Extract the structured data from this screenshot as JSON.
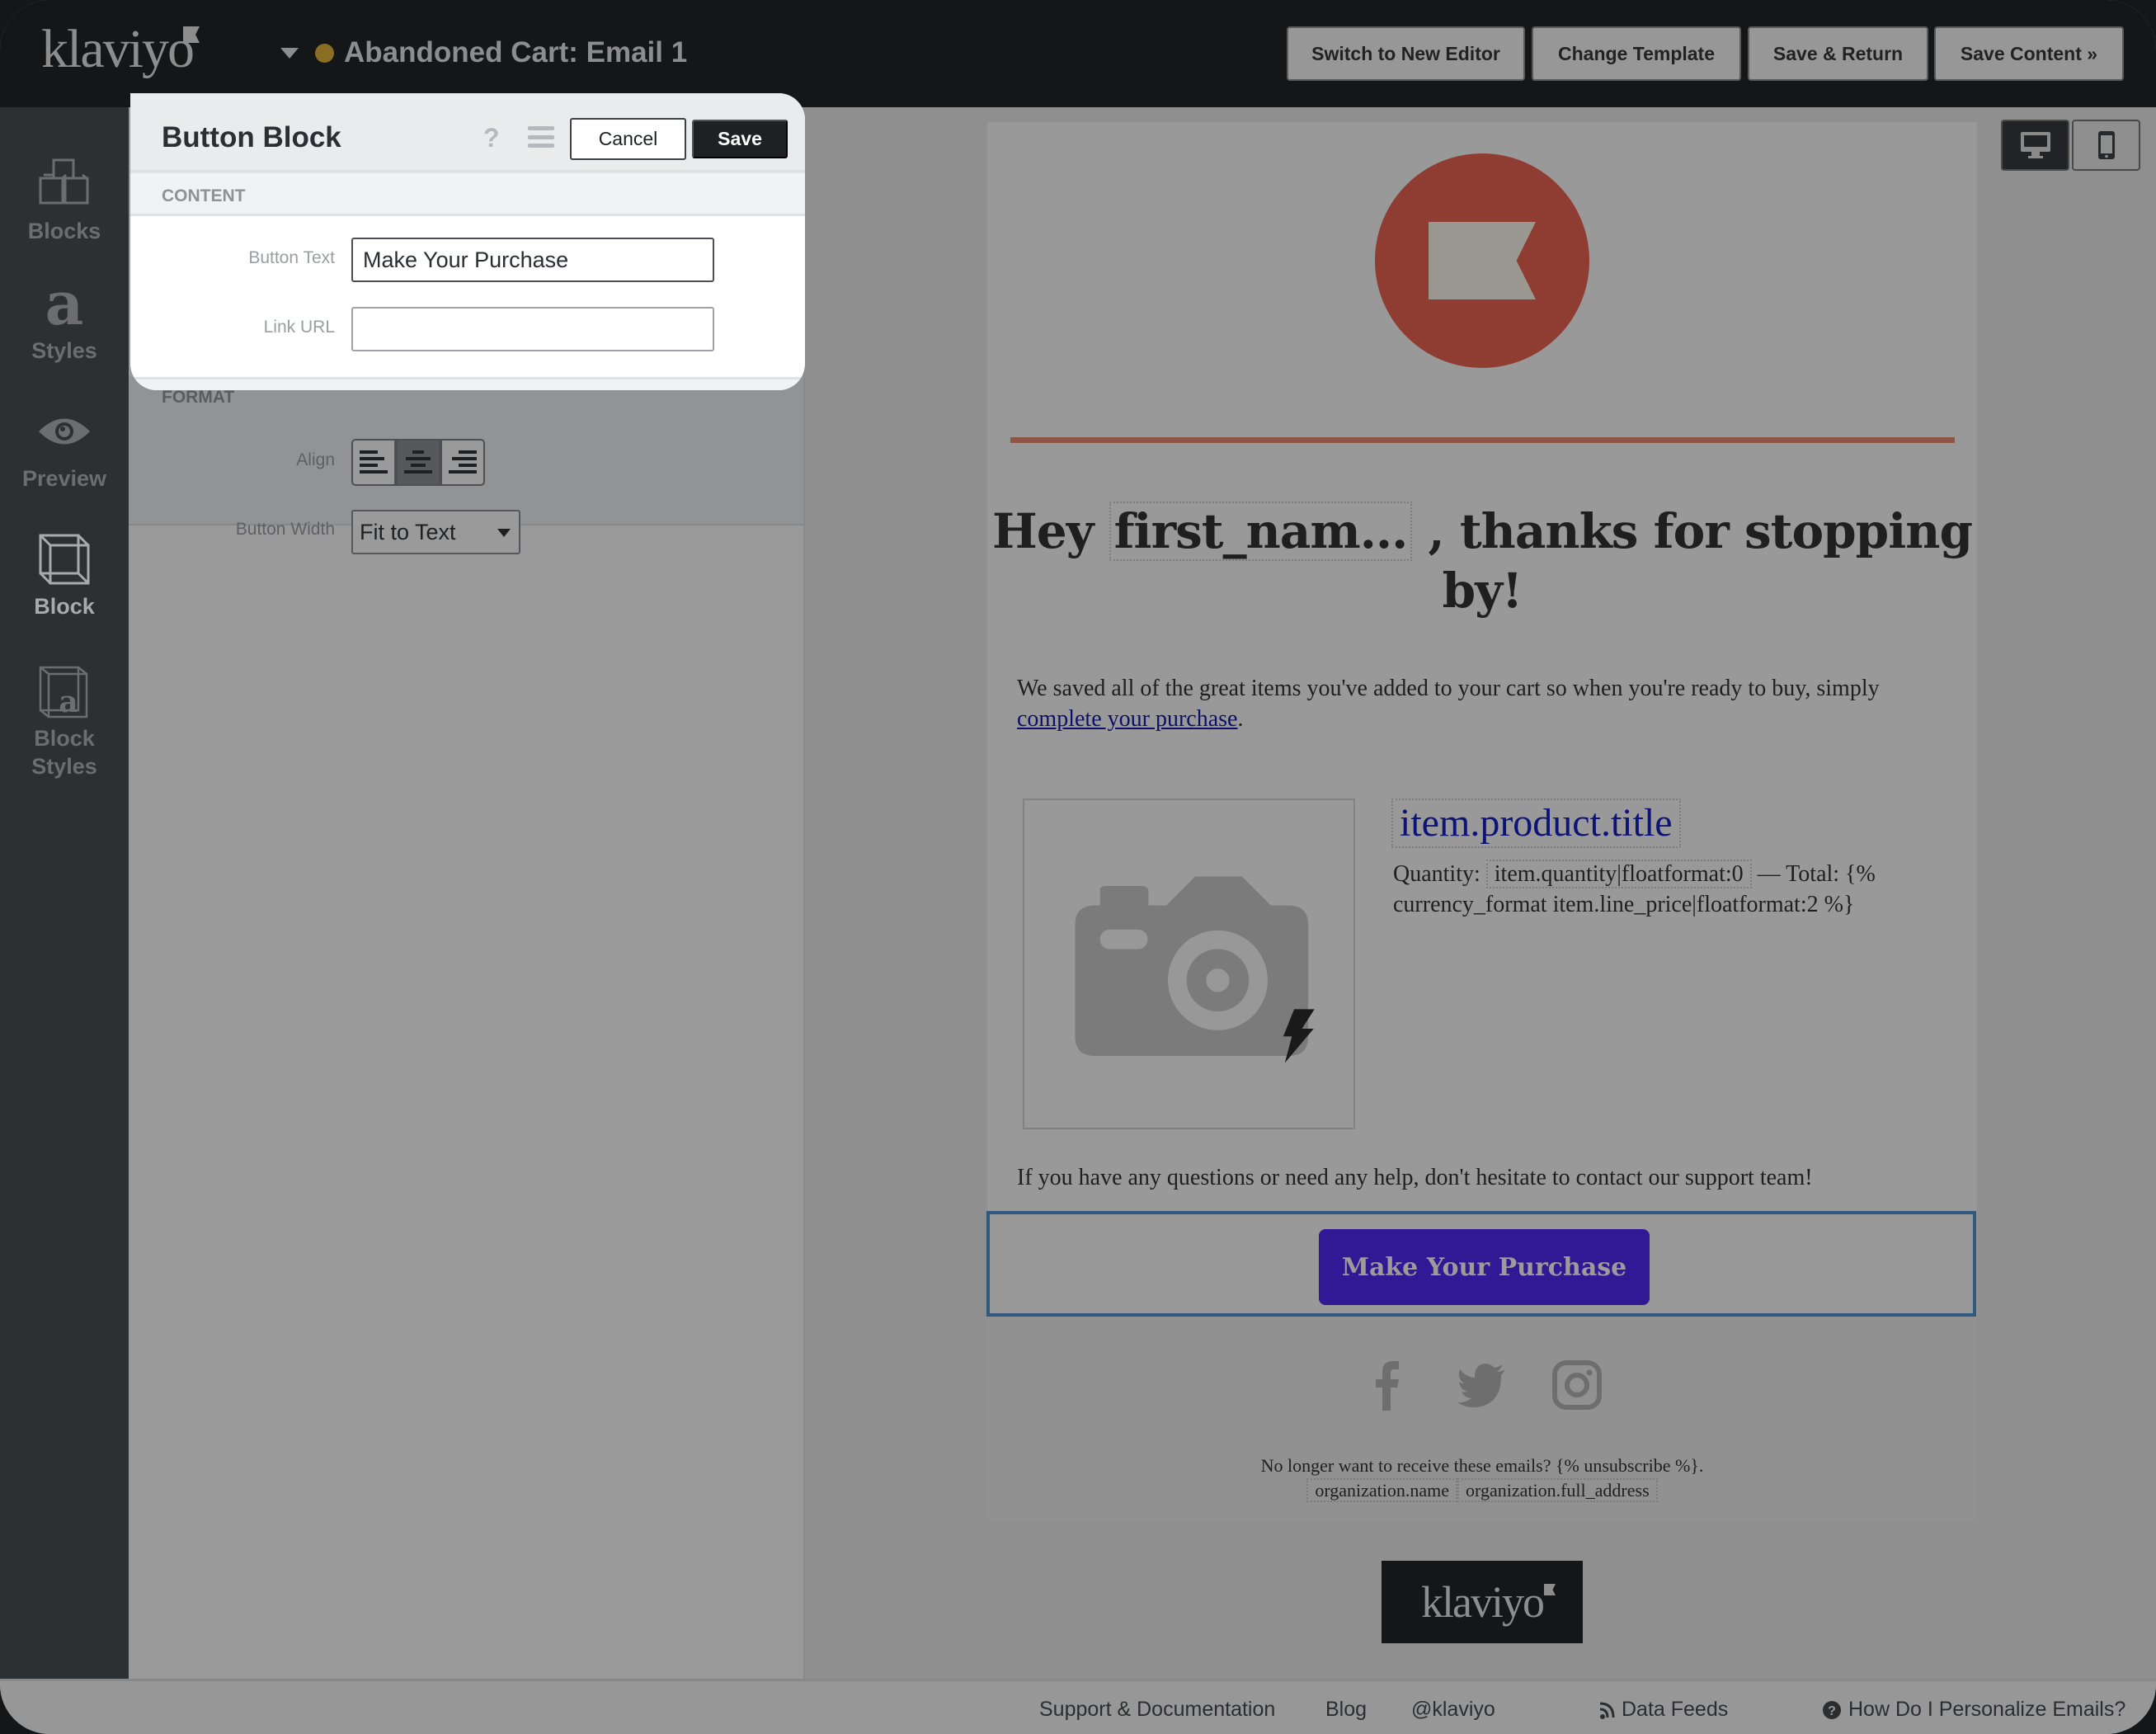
{
  "app": {
    "logo": "klaviyo",
    "email_title": "Abandoned Cart: Email 1",
    "status_color": "#8a6e24"
  },
  "topbar": {
    "buttons": [
      {
        "label": "Switch to New Editor"
      },
      {
        "label": "Change Template"
      },
      {
        "label": "Save & Return"
      },
      {
        "label": "Save Content »"
      }
    ]
  },
  "sidebar": {
    "items": [
      {
        "label": "Blocks",
        "icon": "blocks-icon",
        "active": false
      },
      {
        "label": "Styles",
        "icon": "styles-icon",
        "active": false
      },
      {
        "label": "Preview",
        "icon": "eye-icon",
        "active": false
      },
      {
        "label": "Block",
        "icon": "block-icon",
        "active": true
      },
      {
        "label": "Block Styles",
        "icon": "block-styles-icon",
        "active": false
      }
    ]
  },
  "panel": {
    "title": "Button Block",
    "help_glyph": "?",
    "cancel_label": "Cancel",
    "save_label": "Save",
    "content_section": "CONTENT",
    "button_text_label": "Button Text",
    "button_text_value": "Make Your Purchase",
    "link_url_label": "Link URL",
    "link_url_value": "",
    "format_section": "FORMAT",
    "align_label": "Align",
    "align_options": [
      "left",
      "center",
      "right"
    ],
    "align_selected": "center",
    "button_width_label": "Button Width",
    "button_width_value": "Fit to Text"
  },
  "email": {
    "headline_pre": "Hey ",
    "headline_var": "first_nam...",
    "headline_post": " , thanks for stopping by!",
    "intro_text": "We saved all of the great items you've added to your cart so when you're ready to buy, simply ",
    "intro_link": "complete your purchase",
    "intro_end": ".",
    "product_title": "item.product.title",
    "quantity_label": "Quantity: ",
    "quantity_var": "item.quantity|floatformat:0",
    "total_text": " — Total: {% currency_format item.line_price|floatformat:2 %}",
    "help_text": "If you have any questions or need any help, don't hesitate to contact our support team!",
    "cta_label": "Make Your Purchase",
    "cta_color": "#2f1994",
    "social": [
      "facebook",
      "twitter",
      "instagram"
    ],
    "unsubscribe_text": "No longer want to receive these emails? {% unsubscribe %}.",
    "org_name": "organization.name",
    "org_address": "organization.full_address",
    "badge_logo": "klaviyo"
  },
  "devices": {
    "desktop": "desktop",
    "mobile": "mobile",
    "selected": "desktop"
  },
  "footer": {
    "links": [
      {
        "label": "Support & Documentation"
      },
      {
        "label": "Blog"
      },
      {
        "label": "@klaviyo"
      },
      {
        "label": "Data Feeds",
        "icon": "rss-icon"
      },
      {
        "label": "How Do I Personalize Emails?",
        "icon": "question-circle-icon"
      }
    ]
  }
}
